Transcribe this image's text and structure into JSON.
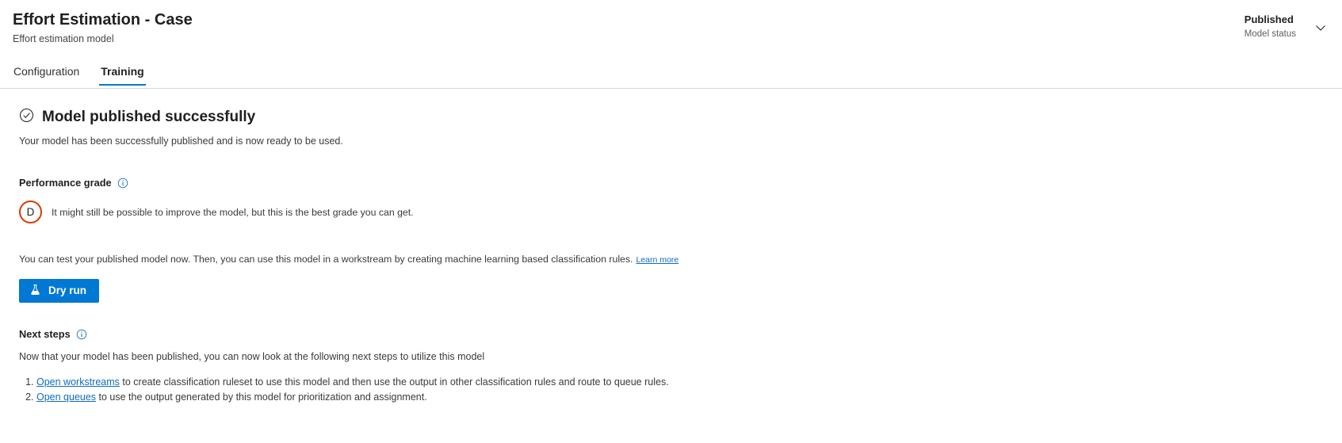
{
  "header": {
    "title": "Effort Estimation - Case",
    "subtitle": "Effort estimation model",
    "status": {
      "value": "Published",
      "label": "Model status",
      "chevron_icon": "chevron-down-icon"
    },
    "tabs": [
      {
        "label": "Configuration",
        "active": false
      },
      {
        "label": "Training",
        "active": true
      }
    ]
  },
  "main": {
    "success": {
      "icon": "check-circle-icon",
      "title": "Model published successfully",
      "description": "Your model has been successfully published and is now ready to be used."
    },
    "performance": {
      "label": "Performance grade",
      "info_icon": "info-icon",
      "grade": "D",
      "grade_color": "#d83b01",
      "grade_description": "It might still be possible to improve the model, but this is the best grade you can get."
    },
    "test": {
      "paragraph": "You can test your published model now. Then, you can use this model in a workstream by creating machine learning based classification rules.",
      "learn_more": "Learn more",
      "dry_run_label": "Dry run",
      "dry_run_icon": "flask-icon",
      "dry_run_color": "#0078d4"
    },
    "next_steps": {
      "label": "Next steps",
      "info_icon": "info-icon",
      "description": "Now that your model has been published, you can now look at the following next steps to utilize this model",
      "items": [
        {
          "link": "Open workstreams",
          "text": " to create classification ruleset to use this model and then use the output in other classification rules and route to queue rules."
        },
        {
          "link": "Open queues",
          "text": " to use the output generated by this model for prioritization and assignment."
        }
      ]
    }
  }
}
